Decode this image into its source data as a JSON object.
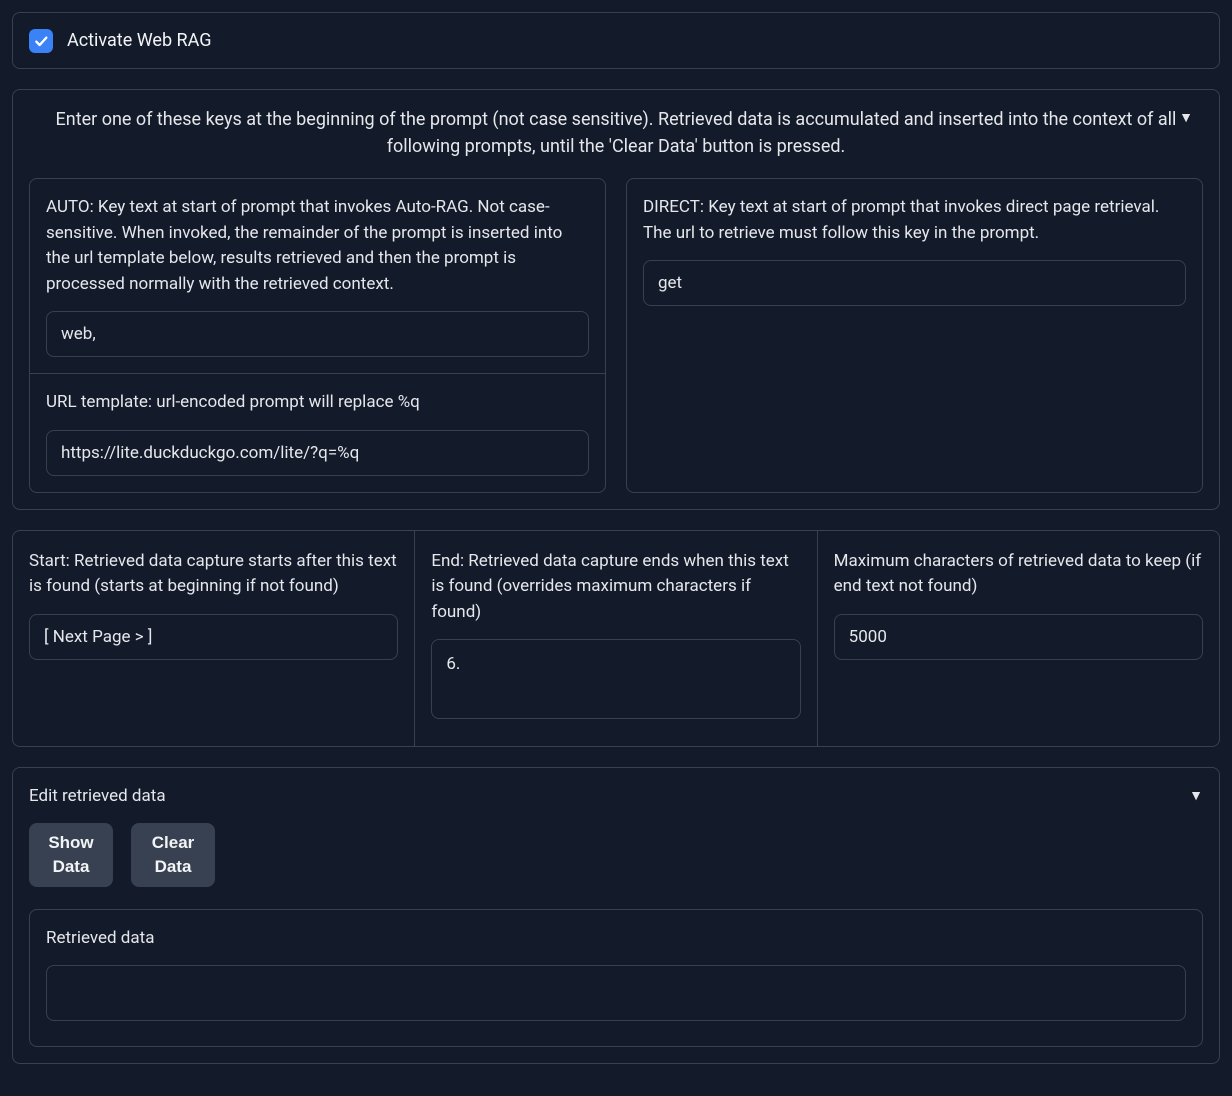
{
  "activate": {
    "label": "Activate Web RAG",
    "checked": true
  },
  "instructions": {
    "header": "Enter one of these keys at the beginning of the prompt (not case sensitive). Retrieved data is accumulated and inserted into the context of all following prompts, until the 'Clear Data' button is pressed.",
    "auto": {
      "description": "AUTO: Key text at start of prompt that invokes Auto-RAG. Not case-sensitive. When invoked, the remainder of the prompt is inserted into the url template below, results retrieved and then the prompt is processed normally with the retrieved context.",
      "value": "web,"
    },
    "url_template": {
      "description": "URL template: url-encoded prompt will replace %q",
      "value": "https://lite.duckduckgo.com/lite/?q=%q"
    },
    "direct": {
      "description": "DIRECT: Key text at start of prompt that invokes direct page retrieval. The url to retrieve must follow this key in the prompt.",
      "value": "get"
    }
  },
  "capture": {
    "start": {
      "description": "Start: Retrieved data capture starts after this text is found (starts at beginning if not found)",
      "value": "[ Next Page > ]"
    },
    "end": {
      "description": "End: Retrieved data capture ends when this text is found (overrides maximum characters if found)",
      "value": "6."
    },
    "max": {
      "description": "Maximum characters of retrieved data to keep (if end text not found)",
      "value": "5000"
    }
  },
  "edit": {
    "header": "Edit retrieved data",
    "show_button": "Show Data",
    "clear_button": "Clear Data",
    "retrieved_label": "Retrieved data",
    "retrieved_value": ""
  }
}
